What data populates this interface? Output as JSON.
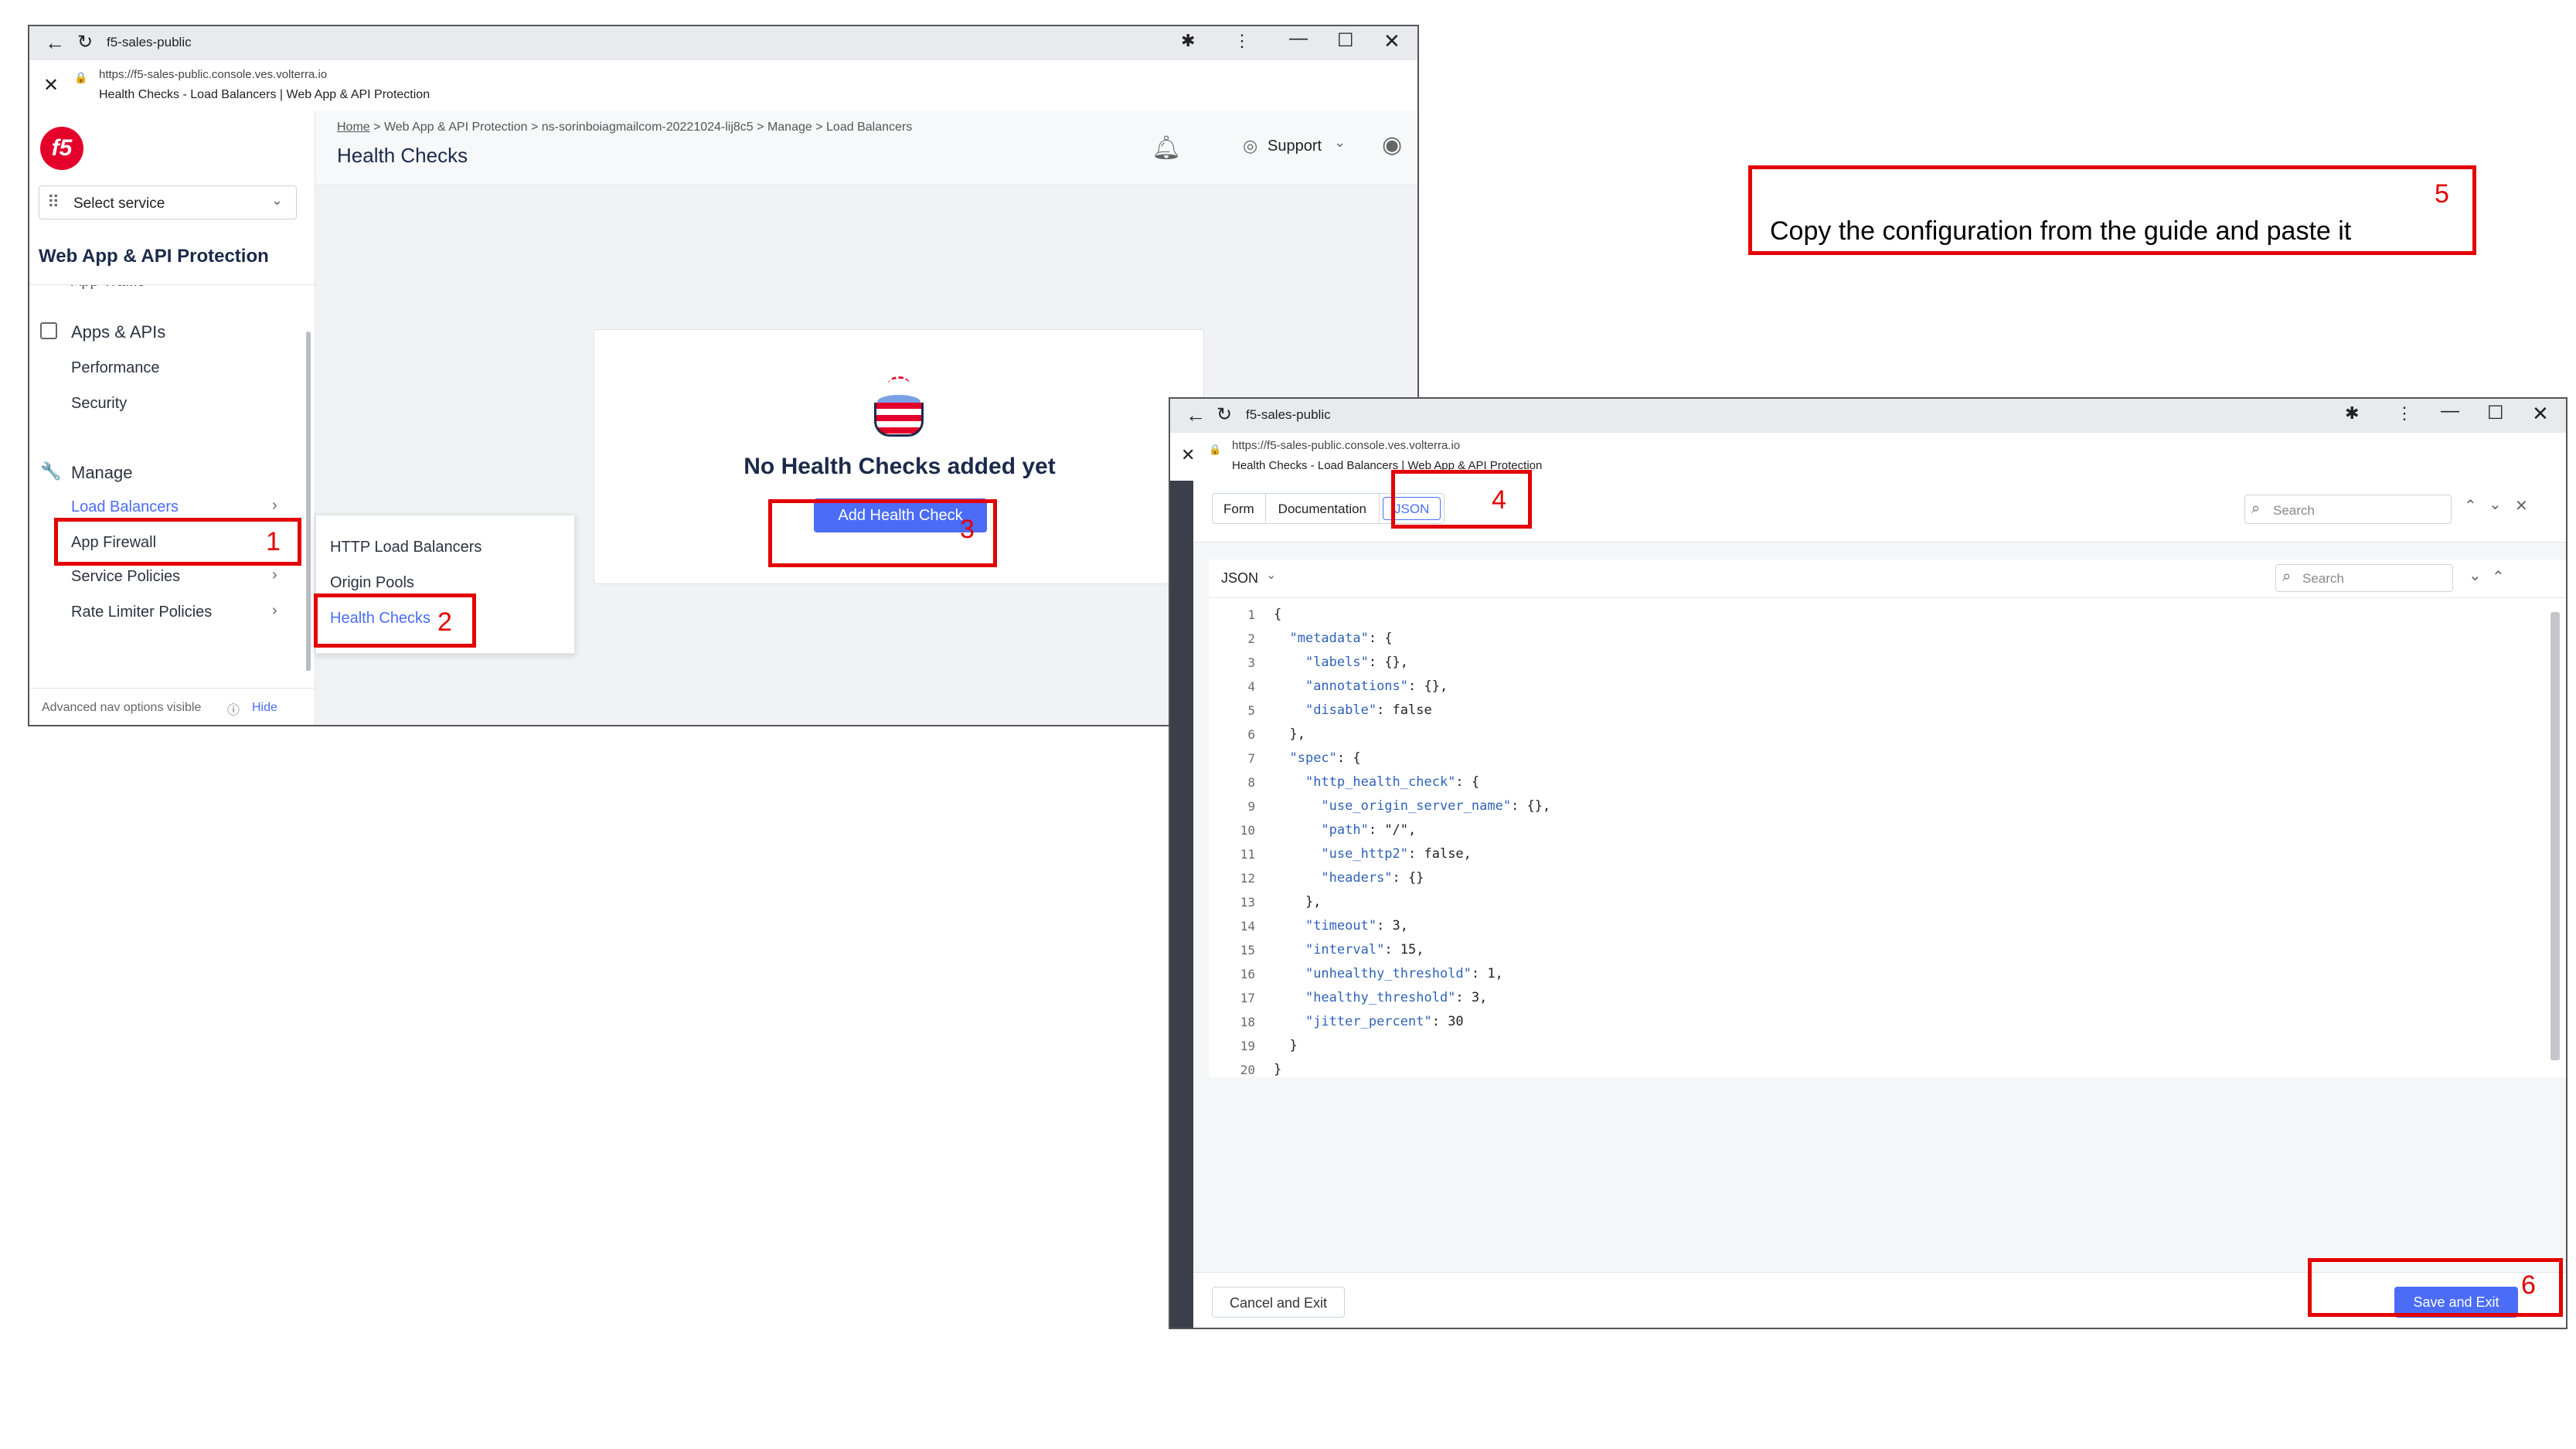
{
  "annotation": {
    "step5_text": "Copy the configuration from the guide and paste it",
    "n1": "1",
    "n2": "2",
    "n3": "3",
    "n4": "4",
    "n5": "5",
    "n6": "6"
  },
  "win1": {
    "tab_title": "f5-sales-public",
    "url": "https://f5-sales-public.console.ves.volterra.io",
    "page_title": "Health Checks - Load Balancers | Web App & API Protection",
    "select_service": "Select service",
    "workspace": "Web App & API Protection",
    "app_traffic": "App Traffic",
    "apps_apis": "Apps & APIs",
    "performance": "Performance",
    "security": "Security",
    "manage": "Manage",
    "load_balancers": "Load Balancers",
    "app_firewall": "App Firewall",
    "service_policies": "Service Policies",
    "rate_limiter": "Rate Limiter Policies",
    "advanced_nav": "Advanced nav options visible",
    "hide": "Hide",
    "breadcrumb": [
      "Home",
      "Web App & API Protection",
      "ns-sorinboiagmailcom-20221024-lij8c5",
      "Manage",
      "Load Balancers"
    ],
    "heading": "Health Checks",
    "support": "Support",
    "submenu": [
      "HTTP Load Balancers",
      "Origin Pools",
      "Health Checks"
    ],
    "empty_title": "No Health Checks added yet",
    "add_button": "Add Health Check"
  },
  "win2": {
    "tab_title": "f5-sales-public",
    "url": "https://f5-sales-public.console.ves.volterra.io",
    "page_title": "Health Checks - Load Balancers | Web App & API Protection",
    "tabs": [
      "Form",
      "Documentation",
      "JSON"
    ],
    "search_placeholder": "Search",
    "editor_mode": "JSON",
    "editor_search": "Search",
    "cancel": "Cancel and Exit",
    "save": "Save and Exit",
    "code_lines": [
      "{",
      "  \"metadata\": {",
      "    \"labels\": {},",
      "    \"annotations\": {},",
      "    \"disable\": false",
      "  },",
      "  \"spec\": {",
      "    \"http_health_check\": {",
      "      \"use_origin_server_name\": {},",
      "      \"path\": \"/\",",
      "      \"use_http2\": false,",
      "      \"headers\": {}",
      "    },",
      "    \"timeout\": 3,",
      "    \"interval\": 15,",
      "    \"unhealthy_threshold\": 1,",
      "    \"healthy_threshold\": 3,",
      "    \"jitter_percent\": 30",
      "  }",
      "}"
    ],
    "line_numbers": [
      "1",
      "2",
      "3",
      "4",
      "5",
      "6",
      "7",
      "8",
      "9",
      "10",
      "11",
      "12",
      "13",
      "14",
      "15",
      "16",
      "17",
      "18",
      "19",
      "20"
    ]
  },
  "colors": {
    "accent": "#4a6cf7",
    "annotation_red": "#e30000",
    "f5_red": "#e4002b"
  }
}
